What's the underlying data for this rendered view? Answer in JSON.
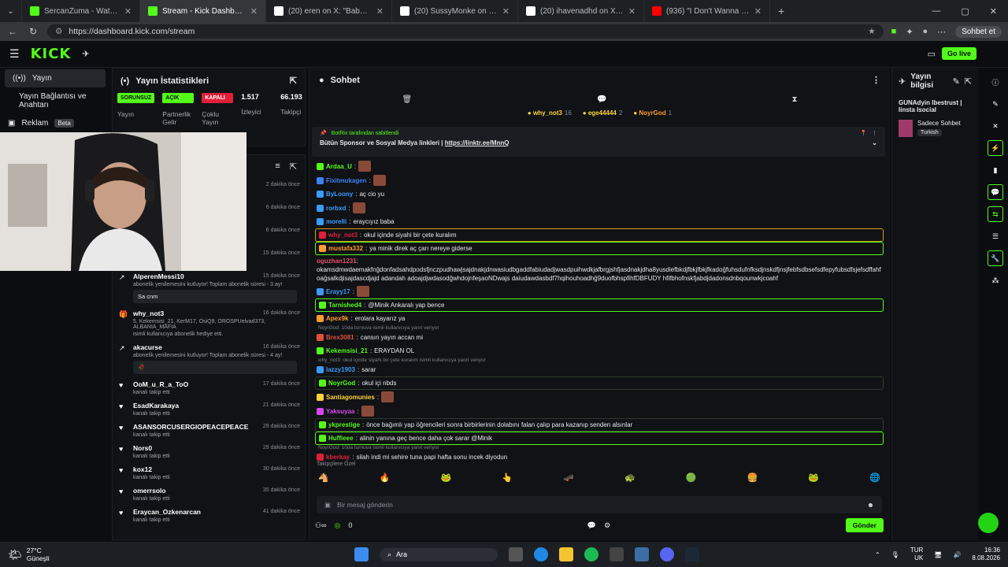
{
  "browser": {
    "tabs": [
      {
        "label": "SercanZuma - Watch clips on Kick",
        "color": "#53fc18",
        "active": false
      },
      {
        "label": "Stream - Kick Dashboard",
        "color": "#53fc18",
        "active": true
      },
      {
        "label": "(20) eren on X: \"Babası zengin diye",
        "color": "#ffffff",
        "active": false
      },
      {
        "label": "(20) SussyMonke on X: \"Miniğin K",
        "color": "#ffffff",
        "active": false
      },
      {
        "label": "(20) ihavenadhd on X: \"Şehmus &",
        "color": "#ffffff",
        "active": false
      },
      {
        "label": "(936) \"I Don't Wanna Go\" - Spider-",
        "color": "#ff0000",
        "active": false
      }
    ],
    "url": "https://dashboard.kick.com/stream",
    "profile_label": "Sohbet et"
  },
  "kick": {
    "logo": "KICK",
    "go_live": "Go live"
  },
  "sidebar": {
    "items": [
      {
        "label": "Yayın",
        "active": true
      },
      {
        "label": "Yayın Bağlantısı ve Anahtarı",
        "active": false
      },
      {
        "label": "Reklam",
        "badge": "Beta",
        "active": false
      }
    ]
  },
  "stats": {
    "title": "Yayın İstatistikleri",
    "cols": [
      {
        "pill": "SORUNSUZ",
        "pill_color": "#53fc18",
        "label": "Yayın"
      },
      {
        "pill": "AÇIK",
        "pill_color": "#53fc18",
        "label": "Partnerlik Gelir"
      },
      {
        "pill": "KAPALI",
        "pill_color": "#e0203a",
        "label": "Çoklu Yayın"
      },
      {
        "value": "1.517",
        "label": "İzleyici"
      },
      {
        "value": "66.193",
        "label": "Takipçi"
      }
    ]
  },
  "activity": {
    "items": [
      {
        "icon": "↗",
        "name": "",
        "time": "2 dakika önce"
      },
      {
        "icon": "↗",
        "name": "",
        "time": "6 dakika önce"
      },
      {
        "icon": "↗",
        "name": "",
        "time": "6 dakika önce"
      },
      {
        "icon": "↗",
        "name": "",
        "sub": "A, hobbitugra isimli",
        "time": "15 dakika önce"
      },
      {
        "icon": "↗",
        "name": "AlperenMessi10",
        "sub": "abonelik yenilemesini kutluyor! Toplam abonelik süresi - 3 ay!",
        "msg": "Sa cnm",
        "time": "15 dakika önce"
      },
      {
        "icon": "🎁",
        "name": "why_not3",
        "sub_green": "5, Kekemsisi_21, KerM17, OsiQ9, OROSPUelvad373, ALBANIA_MAFIA",
        "sub": "isimli kullanıcıya abonelik hediye etti.",
        "time": "16 dakika önce"
      },
      {
        "icon": "↗",
        "name": "akacurse",
        "sub": "abonelik yenilemesini kutluyor! Toplam abonelik süresi - 4 ay!",
        "msg": "🥀",
        "time": "16 dakika önce"
      },
      {
        "icon": "♥",
        "name": "OoM_u_R_a_ToO",
        "sub": "kanalı takip etti",
        "time": "17 dakika önce"
      },
      {
        "icon": "♥",
        "name": "EsadKarakaya",
        "sub": "kanalı takip etti",
        "time": "21 dakika önce"
      },
      {
        "icon": "♥",
        "name": "ASANSORCUSERGIOPEACEPEACE",
        "sub": "kanalı takip etti",
        "time": "29 dakika önce"
      },
      {
        "icon": "♥",
        "name": "Nors0",
        "sub": "kanalı takip etti",
        "time": "29 dakika önce"
      },
      {
        "icon": "♥",
        "name": "kox12",
        "sub": "kanalı takip etti",
        "time": "30 dakika önce"
      },
      {
        "icon": "♥",
        "name": "omerrsolo",
        "sub": "kanalı takip etti",
        "time": "35 dakika önce"
      },
      {
        "icon": "♥",
        "name": "Eraycan_Ozkenarcan",
        "sub": "kanalı takip etti",
        "time": "41 dakika önce"
      }
    ]
  },
  "chat": {
    "title": "Sohbet",
    "top_chatters": [
      {
        "name": "why_not3",
        "count": "16"
      },
      {
        "name": "ege44444",
        "count": "2"
      },
      {
        "name": "NoyrGod",
        "count": "1"
      }
    ],
    "pinned": {
      "by": "BotRix tarafından sabitlendi",
      "text": "Bütün Sponsor ve Sosyal Medya linkleri |",
      "link": "https://linktr.ee/MnnQ"
    },
    "messages": [
      {
        "user": "Ardaa_U",
        "color": "#53fc18",
        "text": "",
        "emote": true,
        "style": ""
      },
      {
        "user": "Fixitmukagen",
        "color": "#3b82f6",
        "text": "",
        "emote": true,
        "style": ""
      },
      {
        "user": "ByLoony",
        "color": "#3b9bff",
        "text": "aç cio yu",
        "style": ""
      },
      {
        "user": "rorbxd",
        "color": "#3b9bff",
        "text": "",
        "emote": true,
        "style": ""
      },
      {
        "user": "morelli",
        "color": "#3b9bff",
        "text": "eraycıyız baba",
        "style": ""
      },
      {
        "user": "why_not3",
        "color": "#e0203a",
        "text": "okul içinde siyahi bir çete kuralım",
        "style": "hl2"
      },
      {
        "user": "mustafa332",
        "color": "#ff9b2f",
        "text": "ya minik direk aç çarı nereye giderse",
        "style": "hl"
      },
      {
        "user": "oguzhan1231",
        "color": "#e0506a",
        "text": "okamsdmwdaemakfnğdonfadsahdpodsfjnczpudhawjsajdnakjdnwasiudbgaddfabiudadjwasdpuihwdkjafbrgjshfjasdnakjdha8yusdiefbkdjfbkjfbkjfkadoğfuhsdufnfksdjnskdfjnsjfebfsdbsefsdfepyfubsdfsjefsdffahfoağsalkdjisajdascdjajd adandah adoajdjwdasodğwhdojnfeşaoNDwajs daiudawdasbdf7hqihouhoadhğ9duofbhspfihfDBFUDY hfifbhofnskfjabdjdadonsdnbqounwkjcoahf",
        "style": "long"
      },
      {
        "user": "Erayy17",
        "color": "#3b9bff",
        "text": "",
        "emote": true,
        "style": ""
      },
      {
        "user": "Tarnished4",
        "color": "#53fc18",
        "text": "@Minik Ankaralı yap bence",
        "style": "hl"
      },
      {
        "user": "Apex9k",
        "color": "#ff9b2f",
        "text": "erolara kayarız ya",
        "style": ""
      },
      {
        "reply": "NoyrGod: 10da turnuva isimli kullanıcıya yanıt veriyor"
      },
      {
        "user": "Brex3081",
        "color": "#e0503a",
        "text": "cansın yayın accan mi",
        "style": ""
      },
      {
        "user": "Kekemsisi_21",
        "color": "#53fc18",
        "text": "ERAYDAN OL",
        "style": ""
      },
      {
        "reply": "why_not3: okul içinde siyahi bir çete kuralım isimli kullanıcıya yanıt veriyor"
      },
      {
        "user": "lazzy1903",
        "color": "#3b9bff",
        "text": "sarar",
        "style": ""
      },
      {
        "user": "NoyrGod",
        "color": "#53fc18",
        "text": "okul içi nbds",
        "style": "dim"
      },
      {
        "user": "Santiagomunies",
        "color": "#ffd43b",
        "text": "",
        "emote": true,
        "style": ""
      },
      {
        "user": "Yaksuyaa",
        "color": "#d946ef",
        "text": "",
        "emote": true,
        "style": ""
      },
      {
        "user": "ykprestige",
        "color": "#53fc18",
        "text": "önce bağımlı yap öğrencileri sonra birbirlerinin dolabını falan çalıp para kazanıp senden alsınlar",
        "style": "dim"
      },
      {
        "user": "Huffieee",
        "color": "#53fc18",
        "text": "alinin yanına geç bence daha çok sarar @Minik",
        "style": "hl"
      },
      {
        "reply": "NoyrGod: 10da turnuva isimli kullanıcıya yanıt veriyor"
      },
      {
        "user": "kberkay",
        "color": "#e0203a",
        "text": "silah indi mi sehire tuna papi hafta sonu incek diyodun",
        "style": ""
      }
    ],
    "emote_label": "Takipçilere Özel",
    "emotes": [
      "🐴",
      "🔥",
      "🐸",
      "👆",
      "🛹",
      "🐢",
      "🟢",
      "🍔",
      "🐸",
      "🌐"
    ],
    "input_placeholder": "Bir mesaj gönderin",
    "points": "0",
    "send": "Gönder"
  },
  "info": {
    "title": "Yayın bilgisi",
    "stream_title": "GUNAdyin Ibestrust | Iinsta Isocial",
    "mode": "Sadece Sohbet",
    "lang": "Turkish"
  },
  "taskbar": {
    "temp": "27°C",
    "weather": "Güneşli",
    "search": "Ara",
    "lang": "TUR",
    "layout": "UK",
    "time": "16:36",
    "date": "8.08.2026"
  }
}
